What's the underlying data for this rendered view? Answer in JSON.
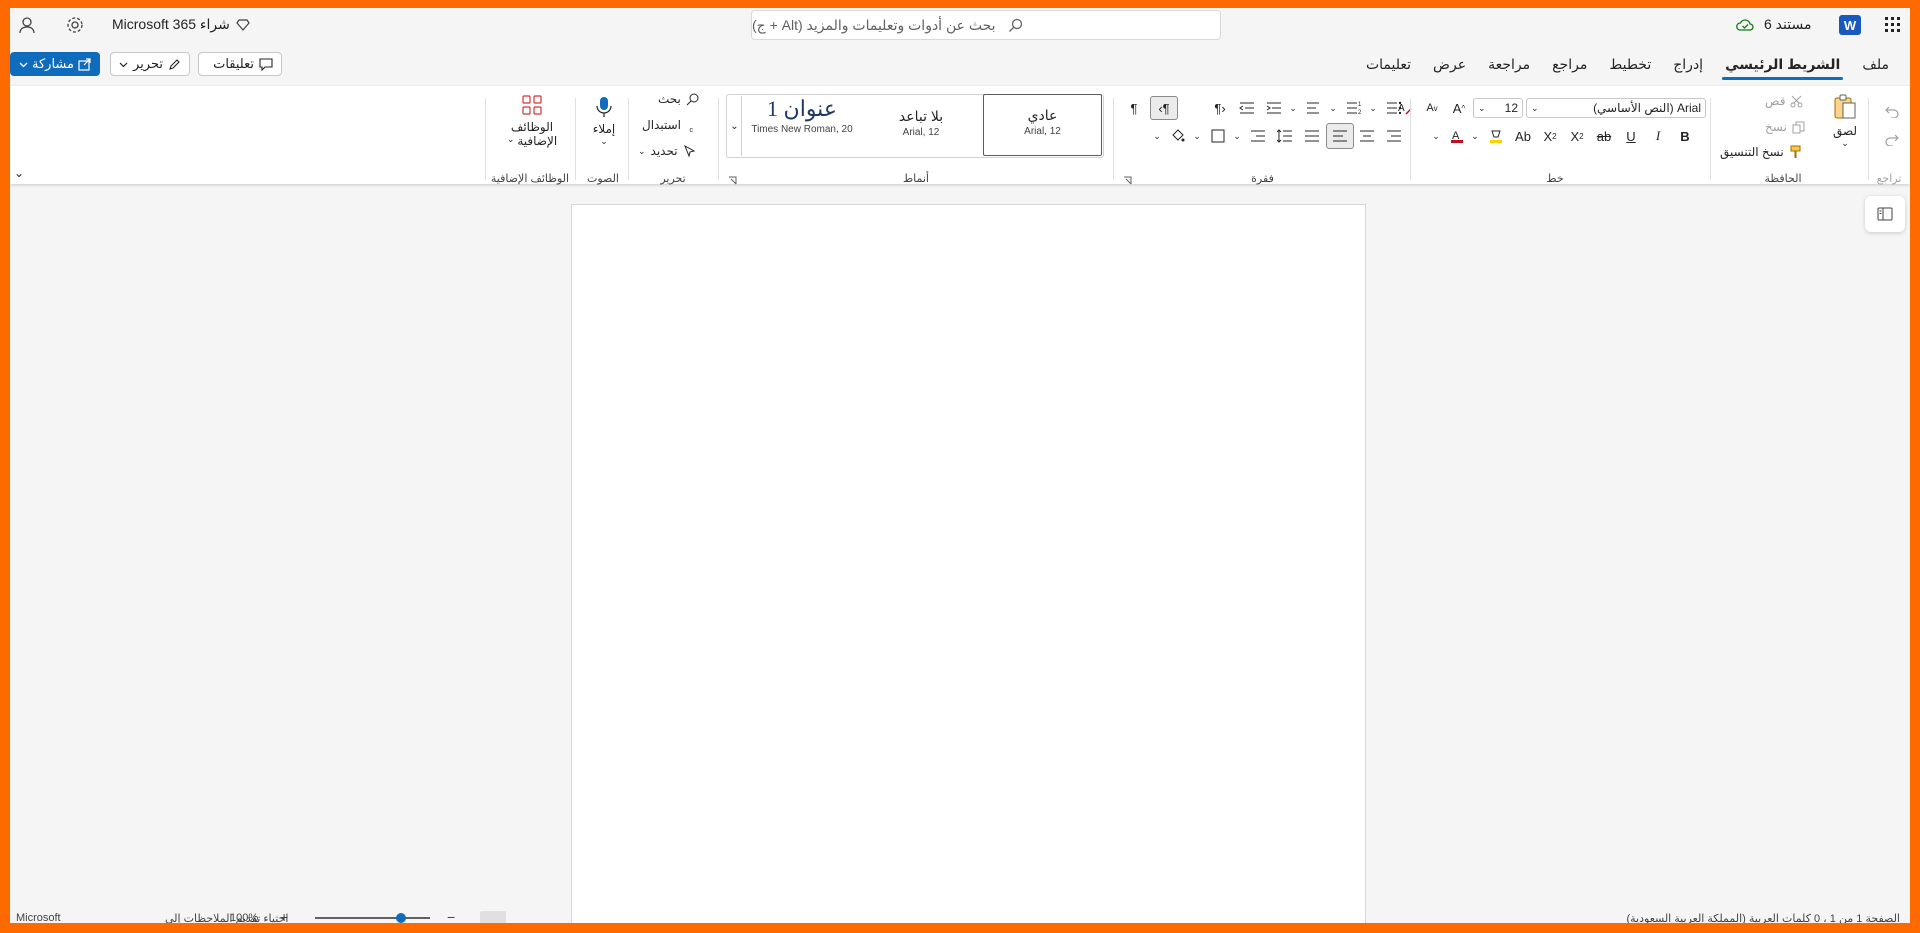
{
  "window": {
    "app_launcher_icon": "waffle-icon",
    "app_icon": "word-icon",
    "doc_title": "مستند 6",
    "save_status_icon": "cloud-saved-icon",
    "search_placeholder": "بحث عن أدوات وتعليمات والمزيد (Alt + ج)",
    "buy_label": "شراء Microsoft 365",
    "settings_icon": "gear-icon",
    "account_icon": "person-icon"
  },
  "actions": {
    "share": "مشاركة",
    "edit": "تحرير",
    "comments": "تعليقات"
  },
  "tabs": [
    {
      "label": "ملف"
    },
    {
      "label": "الشريط الرئيسي",
      "active": true
    },
    {
      "label": "إدراج"
    },
    {
      "label": "تخطيط"
    },
    {
      "label": "مراجع"
    },
    {
      "label": "مراجعة"
    },
    {
      "label": "عرض"
    },
    {
      "label": "تعليمات"
    }
  ],
  "ribbon": {
    "undo_group_label": "تراجع",
    "clipboard": {
      "label": "الحافظة",
      "paste": "لصق",
      "cut": "قص",
      "copy": "نسخ",
      "format_painter": "نسخ التنسيق"
    },
    "font": {
      "label": "خط",
      "font_name": "Arial (النص الأساسي)",
      "font_size": "12"
    },
    "paragraph": {
      "label": "فقرة"
    },
    "styles": {
      "label": "أنماط",
      "items": [
        {
          "name": "عادي",
          "sub": "Arial, 12"
        },
        {
          "name": "بلا تباعد",
          "sub": "Arial, 12"
        },
        {
          "name": "عنوان 1",
          "sub": "Times New Roman, 20"
        }
      ]
    },
    "editing": {
      "label": "تحرير",
      "find": "بحث",
      "replace": "استبدال",
      "select": "تحديد"
    },
    "voice": {
      "label": "الصوت",
      "dictate": "إملاء"
    },
    "addins": {
      "label": "الوظائف الإضافية",
      "button_line1": "الوظائف",
      "button_line2": "الإضافية"
    }
  },
  "statusbar": {
    "left_text": "Microsoft",
    "mid_text": "احتياء تقديم الملاحظات إلى",
    "zoom": "100%",
    "right_text": "الصفحة 1 من 1 ، 0 كلمات العربية (المملكة العربية السعودية)"
  },
  "colors": {
    "accent": "#0f6cbd",
    "frame": "#ff6a00",
    "word_blue": "#185abd"
  }
}
